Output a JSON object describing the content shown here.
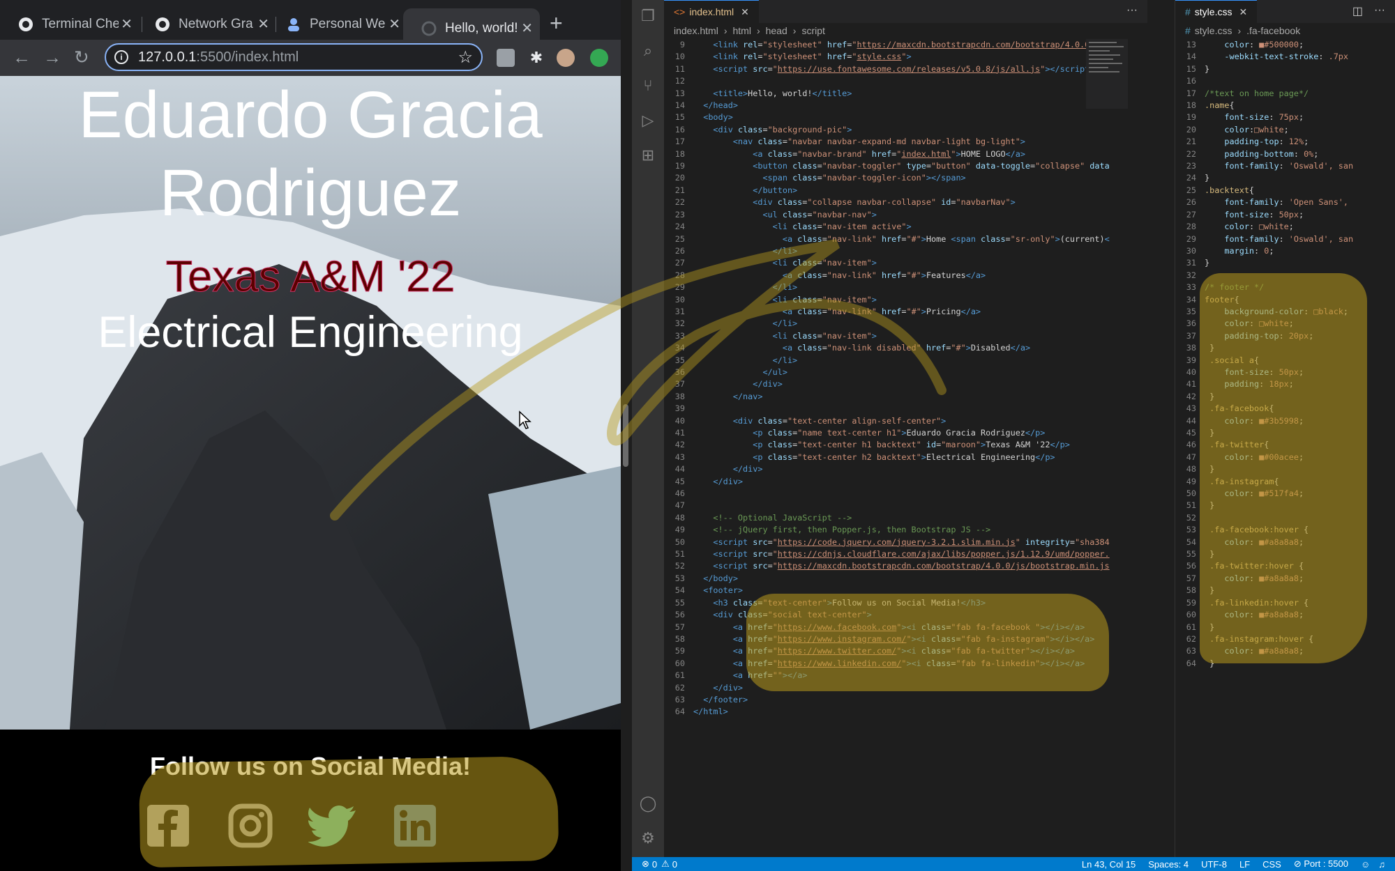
{
  "browser": {
    "tabs": [
      {
        "label": "Terminal Che",
        "icon": "github-icon"
      },
      {
        "label": "Network Gra",
        "icon": "github-icon"
      },
      {
        "label": "Personal We",
        "icon": "person-icon"
      },
      {
        "label": "Hello, world!",
        "icon": "globe-icon"
      }
    ],
    "url_host": "127.0.0.1",
    "url_path": ":5500/index.html"
  },
  "page": {
    "name": "Eduardo Gracia Rodriguez",
    "school": "Texas A&M '22",
    "major": "Electrical Engineering",
    "footer_title": "Follow us on Social Media!",
    "social_icons": [
      "facebook-icon",
      "instagram-icon",
      "twitter-icon",
      "linkedin-icon"
    ]
  },
  "vscode": {
    "editor1": {
      "tab": "index.html",
      "breadcrumbs": [
        "index.html",
        "html",
        "head",
        "script"
      ]
    },
    "editor2": {
      "tab": "style.css",
      "breadcrumbs": [
        "style.css",
        ".fa-facebook"
      ]
    },
    "status": {
      "errors": "0",
      "warnings": "0",
      "position": "Ln 43, Col 15",
      "spaces": "Spaces: 4",
      "encoding": "UTF-8",
      "eol": "LF",
      "language": "CSS",
      "port": "Port : 5500"
    }
  },
  "colors": {
    "vscode_status": "#007acc",
    "highlight": "#b99b1e",
    "maroon": "#500000",
    "facebook": "#3b5998",
    "twitter": "#00acee",
    "instagram": "#517fa4",
    "hover_gray": "#a8a8a8"
  }
}
